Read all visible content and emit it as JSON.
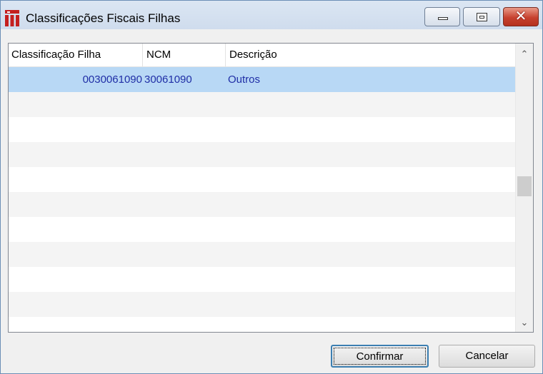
{
  "window": {
    "title": "Classificações Fiscais Filhas",
    "close_glyph": "✕"
  },
  "grid": {
    "columns": [
      "Classificação Filha",
      "NCM",
      "Descrição"
    ],
    "rows": [
      {
        "classificacao": "0030061090",
        "ncm": "30061090",
        "descricao": "Outros"
      }
    ]
  },
  "scrollbar": {
    "up_glyph": "⌃",
    "down_glyph": "⌄"
  },
  "buttons": {
    "confirm_label": "Confirmar",
    "cancel_label": "Cancelar"
  },
  "colors": {
    "selected_row": "#b8d8f5",
    "cell_text": "#1f2ea6",
    "close_button": "#c7412f"
  }
}
